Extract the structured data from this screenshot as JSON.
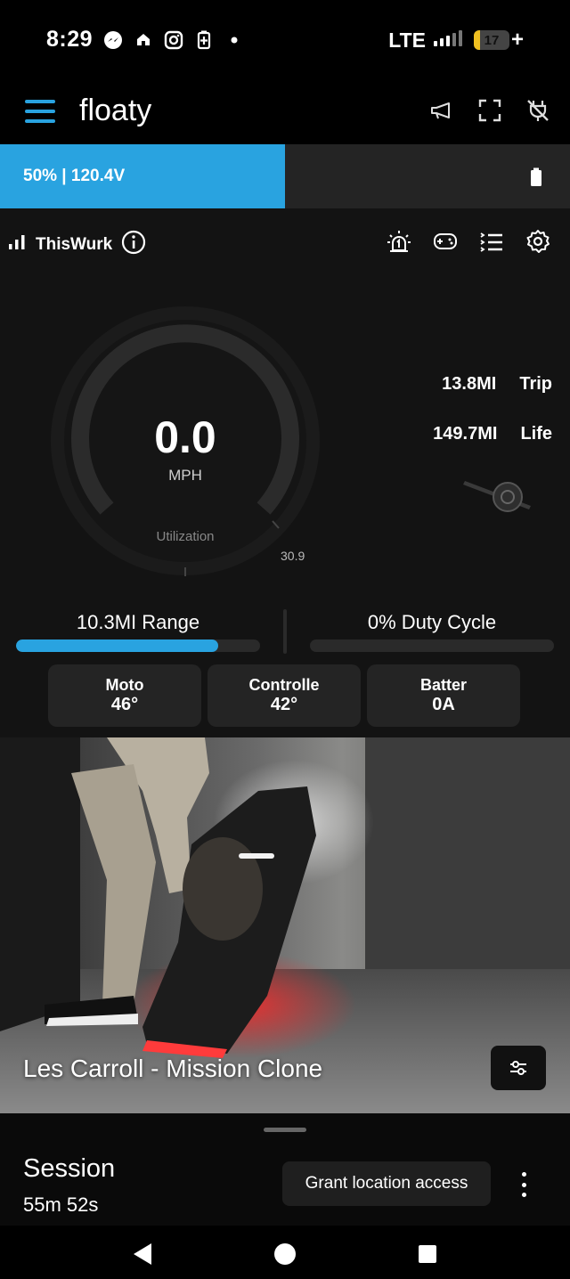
{
  "status_bar": {
    "time": "8:29",
    "icons": [
      "messenger-icon",
      "home-icon",
      "instagram-icon",
      "battery-saver-icon",
      "dot-icon"
    ],
    "network": "LTE",
    "battery_level": "17",
    "battery_percent": 0.17,
    "charging_symbol": "+"
  },
  "app_bar": {
    "title": "floaty",
    "actions": [
      "megaphone-icon",
      "fullscreen-icon",
      "unplugged-icon"
    ]
  },
  "battery_bar": {
    "label": "50% | 120.4V",
    "fill_fraction": 0.5,
    "colors": {
      "fill": "#29a3e0",
      "track": "#242424"
    }
  },
  "board": {
    "name": "ThisWurk",
    "signal_icon": "signal-icon",
    "info_icon": "info-icon",
    "actions": [
      "alarm-icon",
      "gamepad-icon",
      "list-icon",
      "settings-icon"
    ]
  },
  "gauge": {
    "speed": "0.0",
    "unit": "MPH",
    "utilization_label": "Utilization",
    "max_label": "30.9",
    "utilization_fraction": 0.0
  },
  "stats": {
    "trip_value": "13.8MI",
    "trip_label": "Trip",
    "life_value": "149.7MI",
    "life_label": "Life"
  },
  "range": {
    "label": "10.3MI Range",
    "fill_fraction": 0.83
  },
  "duty_cycle": {
    "label": "0% Duty Cycle",
    "fill_fraction": 0.0
  },
  "temps": [
    {
      "title": "Moto",
      "value": "46°"
    },
    {
      "title": "Controlle",
      "value": "42°"
    },
    {
      "title": "Batter",
      "value": "0A"
    }
  ],
  "photo": {
    "caption": "Les Carroll - Mission Clone",
    "button_icon": "tune-icon"
  },
  "session": {
    "title": "Session",
    "duration": "55m 52s",
    "grant_button": "Grant location access",
    "more_icon": "more-vertical-icon"
  },
  "nav": [
    "back-icon",
    "home-icon",
    "recents-icon"
  ],
  "colors": {
    "accent": "#29a3e0",
    "panel": "#131313",
    "card": "#242424"
  }
}
